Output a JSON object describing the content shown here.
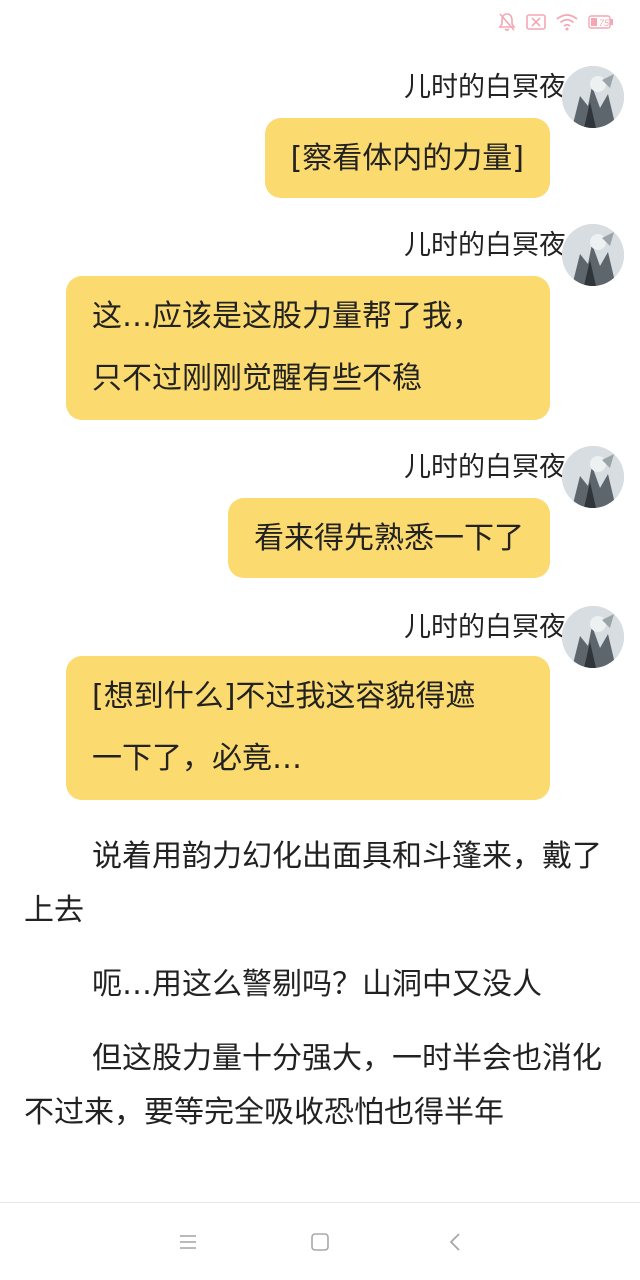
{
  "status_bar": {
    "battery_level": "75",
    "icons": [
      "bell-muted-icon",
      "sim-x-icon",
      "wifi-icon",
      "battery-icon"
    ],
    "icon_color": "#f4a7b4"
  },
  "chat": {
    "accent_color": "#fbda6f",
    "messages": [
      {
        "sender": "儿时的白冥夜",
        "lines": [
          "[察看体内的力量]"
        ]
      },
      {
        "sender": "儿时的白冥夜",
        "lines": [
          "这…应该是这股力量帮了我，",
          "只不过刚刚觉醒有些不稳"
        ]
      },
      {
        "sender": "儿时的白冥夜",
        "lines": [
          "看来得先熟悉一下了"
        ]
      },
      {
        "sender": "儿时的白冥夜",
        "lines": [
          "[想到什么]不过我这容貌得遮",
          "一下了，必竟…"
        ]
      }
    ]
  },
  "narrative": {
    "paragraphs": [
      "说着用韵力幻化出面具和斗篷来，戴了上去",
      "呃…用这么警剔吗？山洞中又没人",
      "但这股力量十分强大，一时半会也消化不过来，要等完全吸收恐怕也得半年"
    ]
  },
  "nav_bar": {
    "buttons": [
      "menu-icon",
      "home-icon",
      "back-icon"
    ]
  }
}
